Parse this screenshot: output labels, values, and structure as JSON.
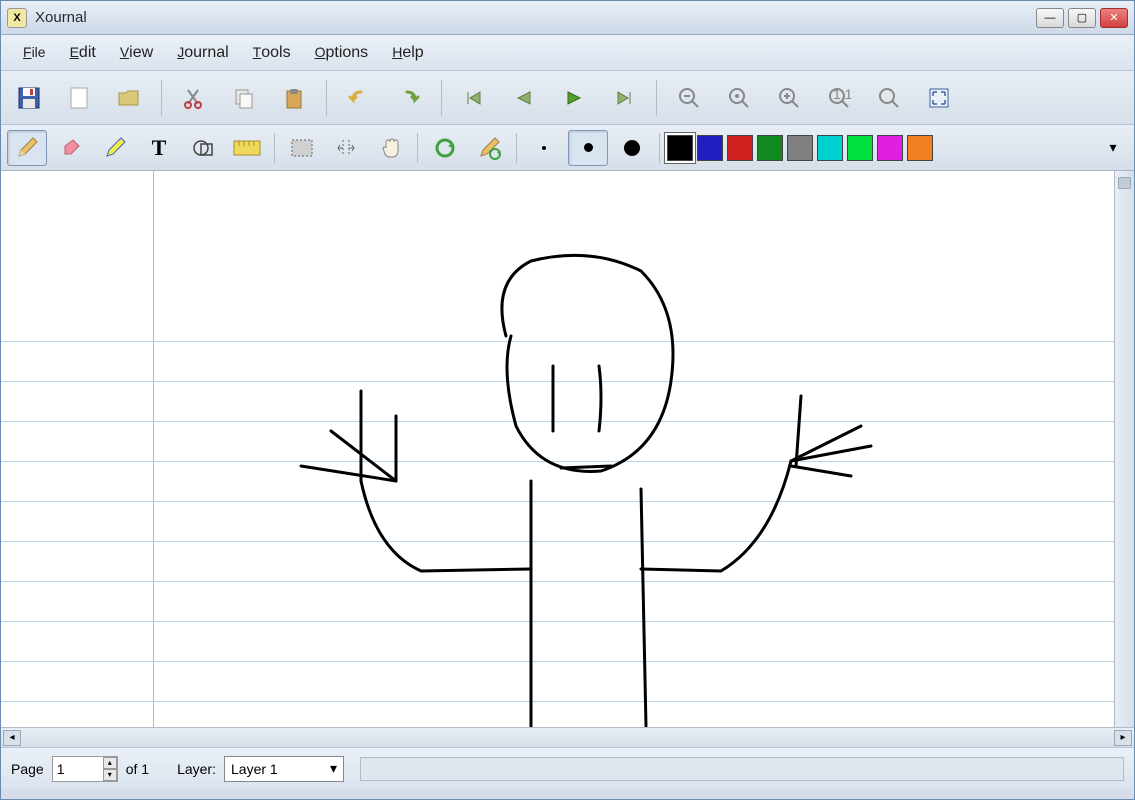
{
  "titlebar": {
    "title": "Xournal"
  },
  "menubar": {
    "items": [
      "File",
      "Edit",
      "View",
      "Journal",
      "Tools",
      "Options",
      "Help"
    ]
  },
  "toolbar1": {
    "icons": [
      "save",
      "new-page",
      "open",
      "cut",
      "copy",
      "paste",
      "undo",
      "redo",
      "go-first",
      "go-prev",
      "go-next",
      "go-last",
      "zoom-out",
      "zoom-reset",
      "zoom-in",
      "zoom-100",
      "zoom-fit",
      "fullscreen"
    ]
  },
  "toolbar2": {
    "tools": [
      "pencil",
      "eraser",
      "highlighter",
      "text",
      "shape",
      "ruler",
      "select-rect",
      "select-vert",
      "hand",
      "refresh",
      "pencil-default"
    ],
    "dot_sizes": [
      "small",
      "medium",
      "large"
    ],
    "colors": [
      "#000000",
      "#2020c0",
      "#d02020",
      "#108a20",
      "#808080",
      "#00d0d0",
      "#00e040",
      "#e020e0",
      "#f08020"
    ],
    "selected_tool": "pencil",
    "selected_dot": "medium",
    "selected_color": "#000000"
  },
  "canvas": {
    "ruled_line_spacing": 40,
    "ruled_line_start": 170,
    "ruled_line_count": 11,
    "margin_left": 152
  },
  "statusbar": {
    "page_label": "Page",
    "page_current": "1",
    "page_total_prefix": "of",
    "page_total": "1",
    "layer_label": "Layer:",
    "layer_value": "Layer 1"
  }
}
